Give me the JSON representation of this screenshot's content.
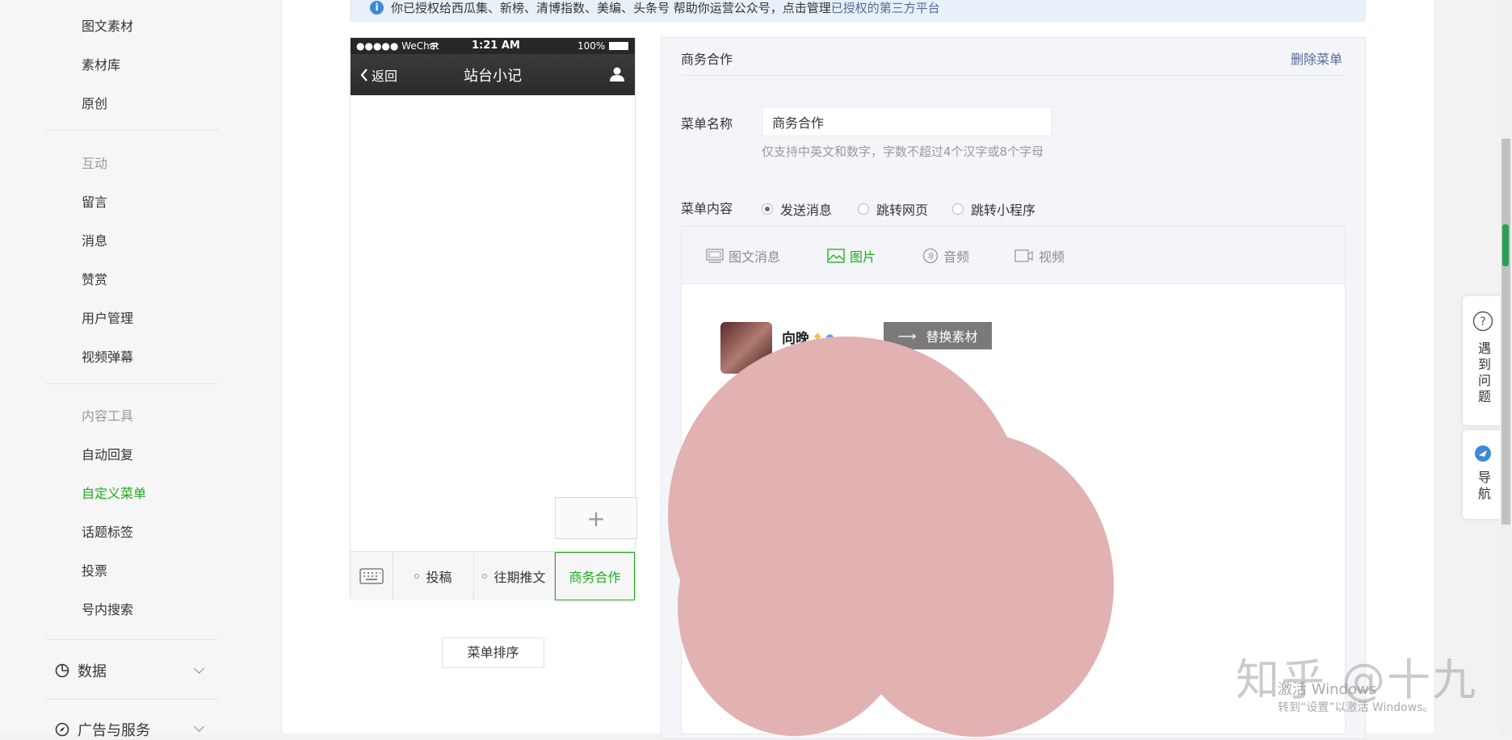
{
  "sidebar": {
    "items_top": [
      "图文素材",
      "素材库",
      "原创"
    ],
    "group_interact": "互动",
    "items_interact": [
      "留言",
      "消息",
      "赞赏",
      "用户管理",
      "视频弹幕"
    ],
    "group_tools": "内容工具",
    "items_tools": [
      "自动回复",
      "自定义菜单",
      "话题标签",
      "投票",
      "号内搜索"
    ],
    "active_item": "自定义菜单",
    "data_label": "数据",
    "ads_label": "广告与服务"
  },
  "notice": {
    "text": "你已授权给西瓜集、新榜、清博指数、美编、头条号 帮助你运营公众号，点击管理",
    "link": "已授权的第三方平台"
  },
  "phone": {
    "carrier": "●●●●● WeChat",
    "time": "1:21 AM",
    "battery": "100%",
    "back": "返回",
    "title": "站台小记",
    "menus": [
      "投稿",
      "往期推文",
      "商务合作"
    ],
    "add_symbol": "+",
    "sort_button": "菜单排序"
  },
  "editor": {
    "header_title": "商务合作",
    "delete_link": "删除菜单",
    "name_label": "菜单名称",
    "name_value": "商务合作",
    "name_hint": "仅支持中英文和数字，字数不超过4个汉字或8个字母",
    "content_label": "菜单内容",
    "radios": [
      "发送消息",
      "跳转网页",
      "跳转小程序"
    ],
    "selected_radio": "发送消息",
    "tabs": [
      "图文消息",
      "图片",
      "音频",
      "视频"
    ],
    "active_tab": "图片",
    "replace_button": "替换素材",
    "profile_name": "向晚"
  },
  "floating": {
    "help": "遇到问题",
    "nav": "导航"
  },
  "watermark": {
    "brand": "知乎 @十九",
    "activate_line1": "激活 Windows",
    "activate_line2": "转到“设置”以激活 Windows。"
  },
  "colors": {
    "accent_green": "#1aad19",
    "link_blue": "#576b95",
    "blob": "#e2b1b1"
  }
}
